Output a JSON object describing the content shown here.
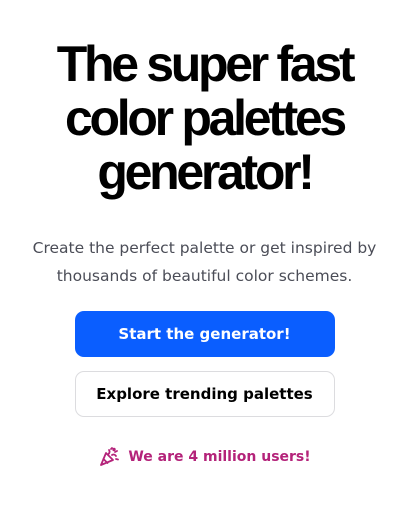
{
  "hero": {
    "headline_line1": "The super fast",
    "headline_line2": "color palettes",
    "headline_line3": "generator!",
    "subtitle_line1": "Create the perfect palette or get inspired by",
    "subtitle_line2": "thousands of beautiful color schemes."
  },
  "actions": {
    "primary_label": "Start the generator!",
    "secondary_label": "Explore trending palettes"
  },
  "social_proof": {
    "icon": "party-popper-icon",
    "text": "We are 4 million users!"
  },
  "colors": {
    "primary": "#0a5eff",
    "accent": "#b4237a",
    "text": "#000000",
    "muted": "#4b4d57"
  }
}
